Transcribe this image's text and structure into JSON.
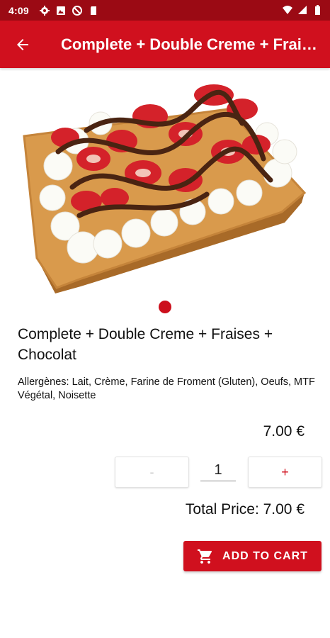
{
  "status_bar": {
    "time": "4:09",
    "icons": [
      "settings-icon",
      "photo-icon",
      "blocked-icon",
      "sd-card-icon",
      "wifi-icon",
      "signal-icon",
      "battery-icon"
    ]
  },
  "app_bar": {
    "title": "Complete + Double Creme + Fraises + Chocolat",
    "back_icon": "arrow-back-icon"
  },
  "product": {
    "name": "Complete + Double Creme + Fraises + Chocolat",
    "allergens": "Allergènes: Lait, Crème, Farine de Froment (Gluten), Oeufs, MTF Végétal, Noisette",
    "unit_price": "7.00 €",
    "image_pages": 1,
    "current_image": 1
  },
  "quantity": {
    "minus_label": "-",
    "value": "1",
    "plus_label": "+"
  },
  "total_price": "Total Price: 7.00 €",
  "add_to_cart": {
    "label": "ADD TO CART",
    "icon": "cart-icon"
  },
  "colors": {
    "status_bar": "#9b0a14",
    "app_bar": "#d0101e",
    "accent": "#d0101e"
  }
}
